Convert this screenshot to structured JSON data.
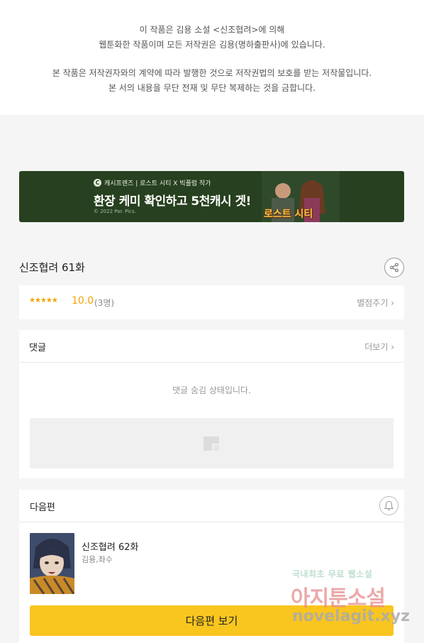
{
  "notice": {
    "line1": "이 작품은 김용 소설 <신조협려>에 의해",
    "line2": "웹툰화한 작품이며 모든 저작권은 김용(명하출판사)에 있습니다.",
    "line3": "본 작품은 저작권자와의 계약에 따라 발행한 것으로 저작권법의 보호를 받는 저작물입니다.",
    "line4": "본 서의 내용을 무단 전재 및 무단 복제하는 것을 금합니다."
  },
  "banner": {
    "top_text": "캐시프렌즈 | 로스트 시티 X 빅플럼 작가",
    "headline": "환장 케미 확인하고 5천캐시 겟!",
    "copyright": "© 2022 Par. Pics.",
    "logo": "로스트 시티"
  },
  "episode": {
    "title": "신조협려 61화"
  },
  "rating": {
    "stars": "★★★★★",
    "score": "10.0",
    "count": "(3명)",
    "rate_button": "별점주기 ›"
  },
  "comments": {
    "title": "댓글",
    "more": "더보기 ›",
    "hidden_text": "댓글 숨김 상태입니다."
  },
  "next_episode": {
    "section_title": "다음편",
    "episode_title": "신조협려 62화",
    "author": "김용,좌수",
    "button_label": "다음편 보기"
  },
  "watermark": {
    "line1_a": "국내최초 무료 ",
    "line1_b": "웹소설",
    "line2": "아지툰소설",
    "line3": "novelagit.xyz"
  }
}
